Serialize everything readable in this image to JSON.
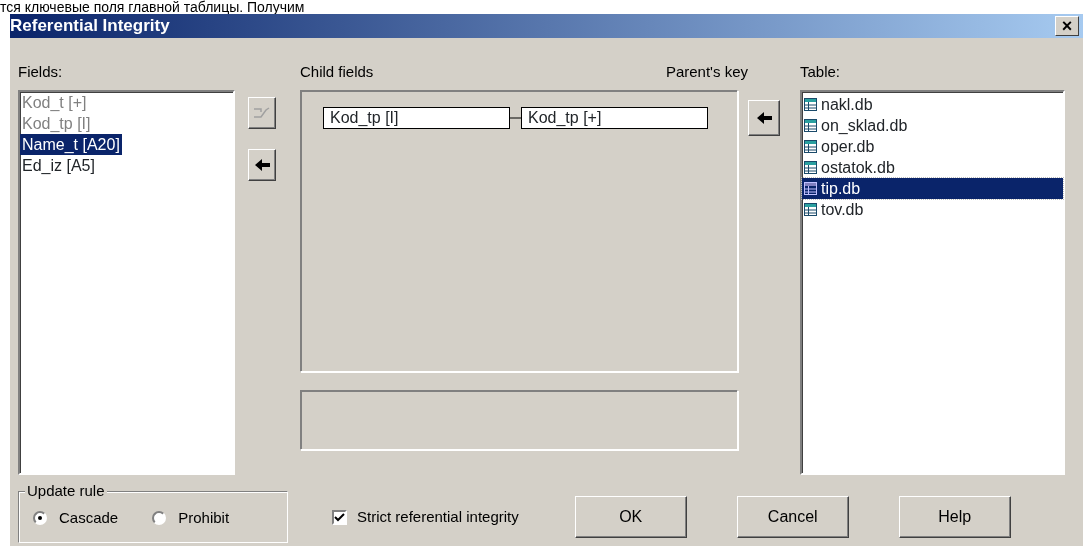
{
  "caption_fragment": "тся ключевые поля главной таблицы. Получим",
  "window": {
    "title": "Referential Integrity",
    "close": "×"
  },
  "fields": {
    "label": "Fields:",
    "items": [
      {
        "text": "Kod_t [+]",
        "disabled": true,
        "selected": false
      },
      {
        "text": "Kod_tp [I]",
        "disabled": true,
        "selected": false
      },
      {
        "text": "Name_t [A20]",
        "disabled": false,
        "selected": true
      },
      {
        "text": "Ed_iz [A5]",
        "disabled": false,
        "selected": false
      }
    ]
  },
  "field_buttons": [
    {
      "kind": "link",
      "disabled": true
    },
    {
      "kind": "arrow",
      "disabled": false
    }
  ],
  "child_fields_label": "Child fields",
  "parents_key_label": "Parent's key",
  "link": {
    "child": "Kod_tp [I]",
    "parent": "Kod_tp [+]"
  },
  "table_button": {
    "kind": "arrow",
    "disabled": false
  },
  "tables": {
    "label": "Table:",
    "items": [
      {
        "text": "nakl.db",
        "selected": false
      },
      {
        "text": "on_sklad.db",
        "selected": false
      },
      {
        "text": "oper.db",
        "selected": false
      },
      {
        "text": "ostatok.db",
        "selected": false
      },
      {
        "text": "tip.db",
        "selected": true
      },
      {
        "text": "tov.db",
        "selected": false
      }
    ]
  },
  "update_rule": {
    "label": "Update rule",
    "options": [
      {
        "label": "Cascade",
        "selected": true
      },
      {
        "label": "Prohibit",
        "selected": false
      }
    ]
  },
  "strict": {
    "label": "Strict referential integrity",
    "checked": true
  },
  "buttons": [
    "OK",
    "Cancel",
    "Help"
  ]
}
